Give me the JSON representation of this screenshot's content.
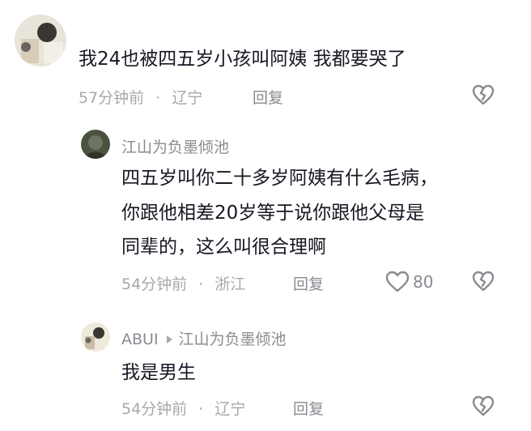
{
  "comments": [
    {
      "text": "我24也被四五岁小孩叫阿姨 我都要哭了",
      "time": "57分钟前",
      "separator": "·",
      "location": "辽宁",
      "reply_label": "回复",
      "avatar_icon": "user-avatar-icon",
      "like_icon": "broken-heart-icon"
    },
    {
      "username": "江山为负墨倾池",
      "lines": [
        "四五岁叫你二十多岁阿姨有什么毛病，",
        "你跟他相差20岁等于说你跟他父母是",
        "同辈的，这么叫很合理啊"
      ],
      "time": "54分钟前",
      "separator": "·",
      "location": "浙江",
      "reply_label": "回复",
      "like_count": "80",
      "avatar_icon": "user-avatar-icon",
      "like_icon": "heart-outline-icon",
      "dislike_icon": "broken-heart-icon"
    },
    {
      "username": "ABUI",
      "reply_to": "江山为负墨倾池",
      "text": "我是男生",
      "time": "54分钟前",
      "separator": "·",
      "location": "辽宁",
      "reply_label": "回复",
      "avatar_icon": "user-avatar-icon",
      "like_icon": "broken-heart-icon"
    }
  ]
}
